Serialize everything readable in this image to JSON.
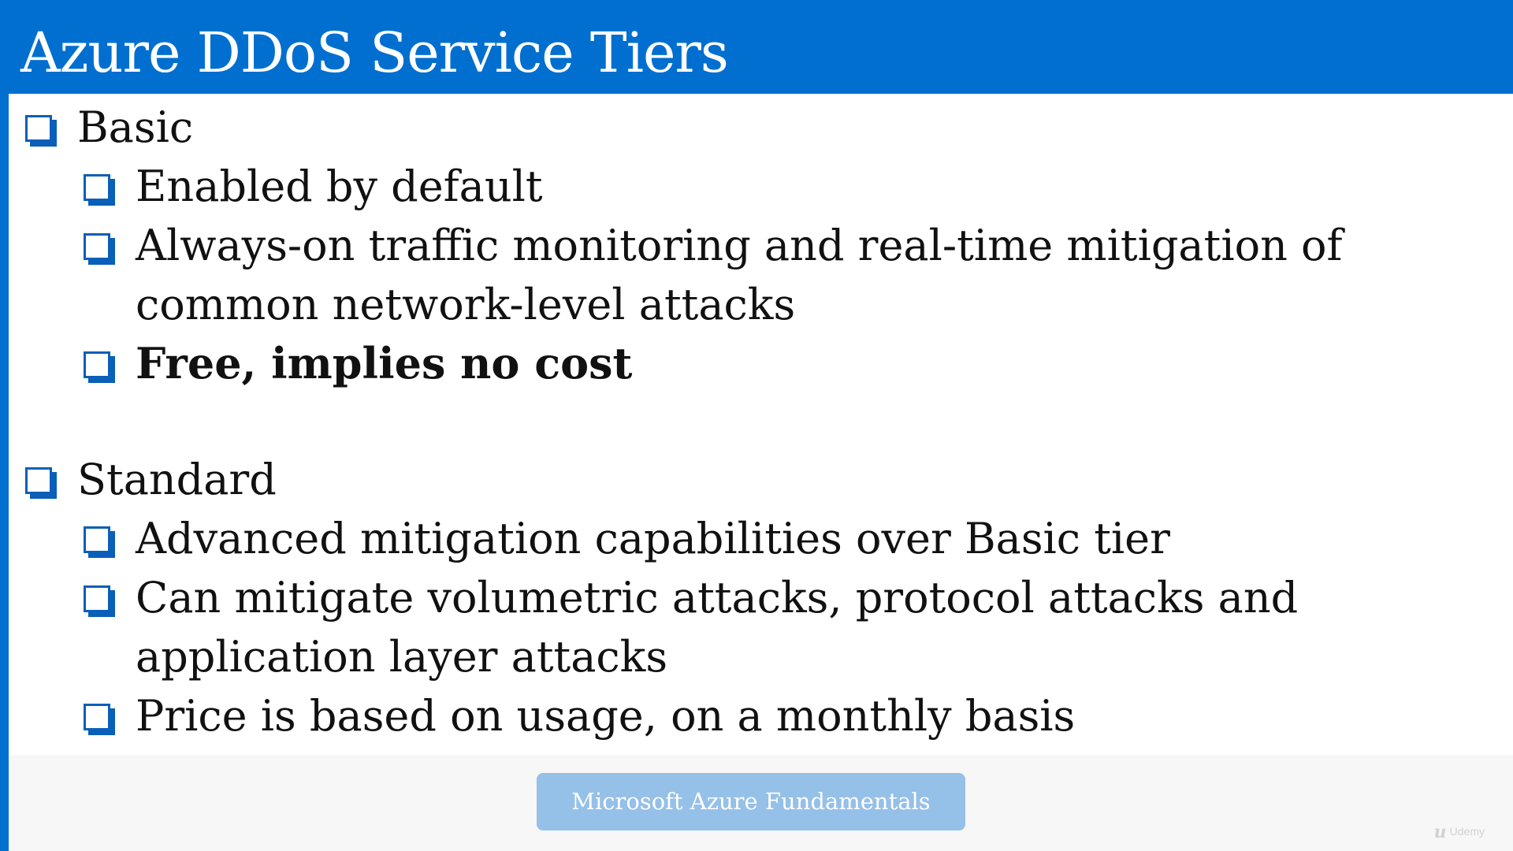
{
  "slide": {
    "title": "Azure DDoS Service Tiers",
    "icon": "checkbox-icon",
    "colors": {
      "accent": "#006fcf",
      "bullet": "#0a5fb8",
      "footer_button": "#95c0e8"
    },
    "tiers": [
      {
        "label": "Basic",
        "points": [
          "Enabled by default",
          "Always-on traffic monitoring and real-time mitigation of",
          "common network-level attacks",
          "Free, implies no cost"
        ]
      },
      {
        "label": "Standard",
        "points": [
          "Advanced mitigation capabilities over Basic tier",
          "Can mitigate volumetric attacks, protocol attacks and",
          "application layer attacks",
          "Price is based on usage, on a monthly basis"
        ]
      }
    ],
    "footer": {
      "button_label": "Microsoft Azure Fundamentals",
      "watermark": "Udemy"
    }
  }
}
